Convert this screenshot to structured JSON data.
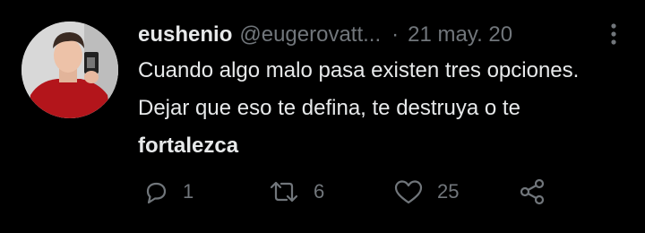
{
  "tweet": {
    "author_name": "eushenio",
    "author_handle": "@eugerovatt...",
    "separator": "·",
    "date": "21 may. 20",
    "text_part1": "Cuando algo malo pasa existen tres opciones. Dejar que eso te defina, te destruya o te ",
    "text_bold": "fortalezca",
    "reply_count": "1",
    "retweet_count": "6",
    "like_count": "25"
  },
  "icons": {
    "reply": "reply-icon",
    "retweet": "retweet-icon",
    "like": "heart-icon",
    "share": "share-icon",
    "more": "more-options-icon"
  },
  "colors": {
    "background": "#000000",
    "primary_text": "#e7e9ea",
    "secondary_text": "#71767b"
  }
}
